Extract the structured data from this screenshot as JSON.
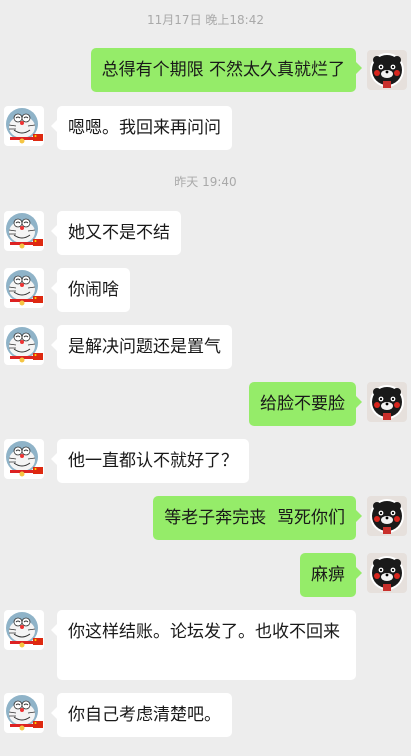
{
  "timestamps": [
    "11月17日 晚上18:42",
    "昨天 19:40"
  ],
  "messages": [
    {
      "side": "out",
      "text": "总得有个期限 不然太久真就烂了"
    },
    {
      "side": "in",
      "text": "嗯嗯。我回来再问问"
    },
    {
      "side": "in",
      "text": "她又不是不结"
    },
    {
      "side": "in",
      "text": "你闹啥"
    },
    {
      "side": "in",
      "text": "是解决问题还是置气"
    },
    {
      "side": "out",
      "text": "给脸不要脸"
    },
    {
      "side": "in",
      "text": "他一直都认不就好了？"
    },
    {
      "side": "out",
      "text": "等老子奔完丧  骂死你们"
    },
    {
      "side": "out",
      "text": "麻痹"
    },
    {
      "side": "in",
      "text": "你这样结账。论坛发了。也收不回来"
    },
    {
      "side": "in",
      "text": "你自己考虑清楚吧。"
    }
  ],
  "avatars": {
    "contact": "doraemon-avatar",
    "self": "kumamon-avatar"
  }
}
